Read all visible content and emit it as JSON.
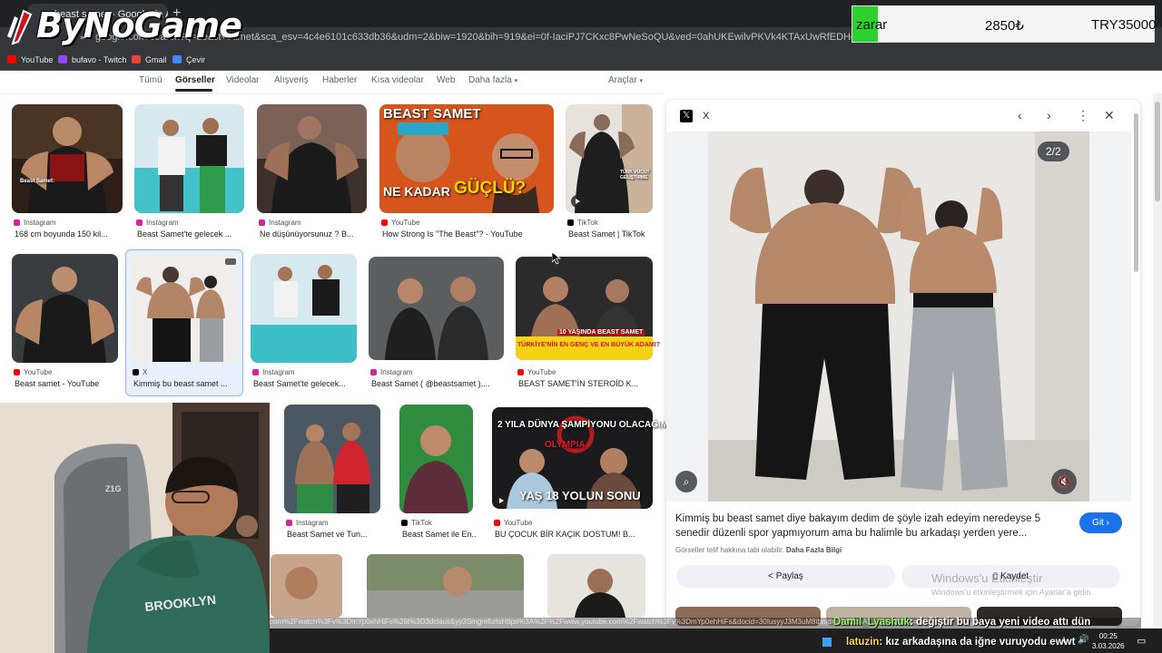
{
  "browser": {
    "tab_title": "beast samet - Google'da Ara",
    "url": "google.com/search?q=beast+samet&sca_esv=4c4e6101c633db36&udm=2&biw=1920&bih=919&ei=0f-IaciPJ7CKxc8PwNeSoQU&ved=0ahUKEwilvPKVk4KTAxUwRfEDHcCrJFQQ4dUDCBE&uact=5&oq=beast",
    "bookmarks": [
      {
        "label": "YouTube",
        "color": "#ff0000"
      },
      {
        "label": "bufavo - Twitch",
        "color": "#9146ff"
      },
      {
        "label": "Gmail",
        "color": "#ea4335"
      },
      {
        "label": "Çevir",
        "color": "#4285f4"
      }
    ]
  },
  "overlay": {
    "logo_text": "ByNoGame",
    "ticker": {
      "label": "zarar",
      "value1": "2850₺",
      "value2": "TRY35000"
    }
  },
  "nav": {
    "tabs": [
      "Tümü",
      "Görseller",
      "Videolar",
      "Alışveriş",
      "Haberler",
      "Kısa videolar",
      "Web",
      "Daha fazla"
    ],
    "tools": "Araçlar"
  },
  "results": [
    {
      "source": "Instagram",
      "title": "168 cm boyunda 150 kil..."
    },
    {
      "source": "Instagram",
      "title": "Beast Samet'te gelecek ..."
    },
    {
      "source": "Instagram",
      "title": "Ne düşünüyorsunuz ? B..."
    },
    {
      "source": "YouTube",
      "title": "How Strong Is \"The Beast\"? - YouTube"
    },
    {
      "source": "TikTok",
      "title": "Beast Samet | TikTok"
    },
    {
      "source": "YouTube",
      "title": "Beast samet - YouTube"
    },
    {
      "source": "X",
      "title": "Kimmiş bu beast samet ..."
    },
    {
      "source": "Instagram",
      "title": "Beast Samet'te gelecek..."
    },
    {
      "source": "Instagram",
      "title": "Beast Samet ( @beastsamet ),..."
    },
    {
      "source": "YouTube",
      "title": "BEAST SAMET'İN STEROİD K..."
    },
    {
      "source": "Instagram",
      "title": "Beast Samet ve Tun..."
    },
    {
      "source": "TikTok",
      "title": "Beast Samet ile En..."
    },
    {
      "source": "YouTube",
      "title": "BU ÇOCUK BİR KAÇIK DOSTUM! B..."
    }
  ],
  "thumb_captions": {
    "beast_samet": "BEAST SAMET",
    "ne_kadar": "NE KADAR",
    "guclu": "GÜÇLÜ?",
    "turk_vucut": "TÜRK VÜCUT GELİŞTİRME",
    "on_yasinda": "10 YAŞINDA BEAST SAMET",
    "turkiyenin": "TÜRKİYE'NİN EN GENÇ VE EN BÜYÜK ADAMI?",
    "iki_yila": "2 YILA DÜNYA ŞAMPİYONU OLACAĞIM",
    "olympia": "OLYMPIA",
    "yas_18": "YAŞ 18 YOLUN SONU",
    "beast_samet_small": "Beast Samet:"
  },
  "panel": {
    "source": "X",
    "count": "2/2",
    "description": "Kimmiş bu beast samet diye bakayım dedim de şöyle izah edeyim neredeyse 5 senedir düzenli spor yapmıyorum ama bu halimle bu arkadaşı yerden yere...",
    "go_label": "Git",
    "license_text": "Görseller telif hakkına tabi olabilir.",
    "license_link": "Daha Fazla Bilgi",
    "share_label": "Paylaş",
    "save_label": "Kaydet"
  },
  "windows": {
    "activate_title": "Windows'u Etkinleştir",
    "activate_sub": "Windows'u etkinleştirmek için Ayarlar'a gidin."
  },
  "stream": {
    "status_url": "com%2Fwatch%3Fv%3DmYp0ehHiFs%26t%3D3dclaus&yy3SmgrefurlsHttps%3A%2F%2Fwww.youtube.com%2Fwatch%3Fv%3DmYp0ehHiFs&docid=30IusyyJ3M3uM8tbnid=Cly8ZpoA7...&w=480&h=cb...",
    "chat": [
      {
        "user": "Daniil_Lyashuk",
        "text": ": değiştir bu baya yeni video attı dün"
      },
      {
        "user": "latuzin",
        "text": ": kız arkadaşına da iğne vuruyodu ewwt"
      }
    ],
    "clock_time": "00:25",
    "clock_date": "3.03.2026",
    "webcam_brand": "Z1G",
    "hoodie_text": "BROOKLYN"
  },
  "colors": {
    "accent_blue": "#1a73e8",
    "ticker_green": "#2dd12d",
    "chat_user1": "#8ff05f",
    "chat_user2": "#ffd54a"
  }
}
